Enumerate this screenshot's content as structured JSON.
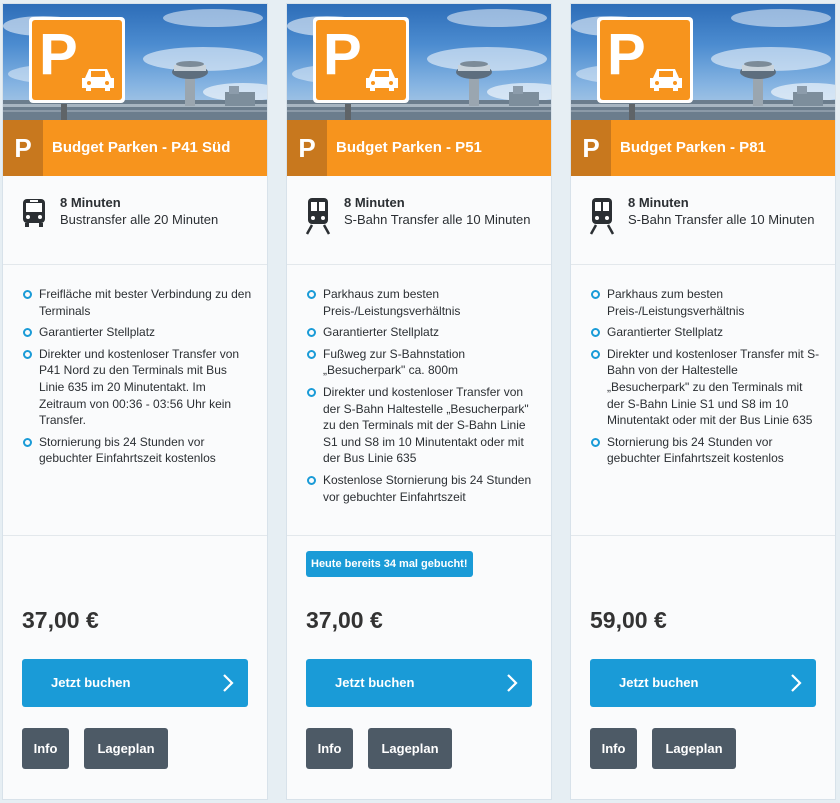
{
  "colors": {
    "accent_orange": "#f7941d",
    "accent_orange_dark": "#c8781e",
    "primary_blue": "#1a9bd7",
    "button_grey": "#4d5a66",
    "card_bg": "#ffffff",
    "page_bg": "#e6eef3"
  },
  "cards": [
    {
      "parking_letter": "P",
      "name": "Budget Parken - P41 Süd",
      "transfer": {
        "icon": "bus-icon",
        "minutes": "8 Minuten",
        "description": "Bustransfer alle 20 Minuten"
      },
      "features": [
        "Freifläche mit bester Verbindung zu den Terminals",
        "Garantierter Stellplatz",
        "Direkter und kostenloser Transfer von P41 Nord zu den Terminals mit Bus Linie 635 im 20 Minutentakt. Im Zeitraum von 00:36 - 03:56 Uhr kein Transfer.",
        "Stornierung bis 24 Stunden vor gebuchter Einfahrtszeit kostenlos"
      ],
      "badge": "",
      "price": "37,00 €",
      "book_label": "Jetzt buchen",
      "info_label": "Info",
      "plan_label": "Lageplan"
    },
    {
      "parking_letter": "P",
      "name": "Budget Parken - P51",
      "transfer": {
        "icon": "train-icon",
        "minutes": "8 Minuten",
        "description": "S-Bahn Transfer alle 10 Minuten"
      },
      "features": [
        "Parkhaus zum besten Preis-/Leistungsverhältnis",
        "Garantierter Stellplatz",
        "Fußweg zur S-Bahnstation „Besucherpark\" ca. 800m",
        "Direkter und kostenloser Transfer von der S-Bahn Haltestelle „Besucherpark\" zu den Terminals mit der S-Bahn Linie S1 und S8 im 10 Minutentakt oder mit der Bus Linie 635",
        "Kostenlose Stornierung bis 24 Stunden vor gebuchter Einfahrtszeit"
      ],
      "badge": "Heute bereits 34 mal gebucht!",
      "price": "37,00 €",
      "book_label": "Jetzt buchen",
      "info_label": "Info",
      "plan_label": "Lageplan"
    },
    {
      "parking_letter": "P",
      "name": "Budget Parken - P81",
      "transfer": {
        "icon": "train-icon",
        "minutes": "8 Minuten",
        "description": "S-Bahn Transfer alle 10 Minuten"
      },
      "features": [
        "Parkhaus zum besten Preis-/Leistungsverhältnis",
        "Garantierter Stellplatz",
        "Direkter und kostenloser Transfer mit S-Bahn von der Haltestelle „Besucherpark\" zu den Terminals mit der S-Bahn Linie S1 und S8 im 10 Minutentakt oder mit der Bus Linie 635",
        "Stornierung bis 24 Stunden vor gebuchter Einfahrtszeit kostenlos"
      ],
      "badge": "",
      "price": "59,00 €",
      "book_label": "Jetzt buchen",
      "info_label": "Info",
      "plan_label": "Lageplan"
    }
  ]
}
